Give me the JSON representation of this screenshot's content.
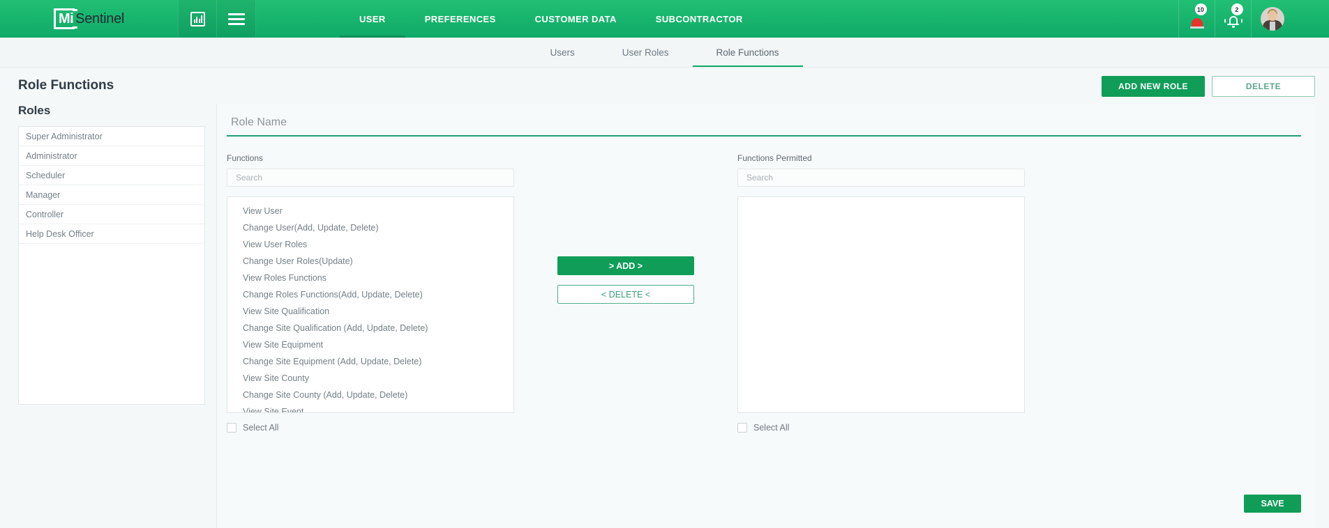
{
  "header": {
    "logo": {
      "mi": "Mi",
      "sentinel": "Sentinel",
      "icon": "logo-misentinel"
    },
    "dashboard_icon": "bar-chart-icon",
    "menu_icon": "hamburger-menu-icon",
    "nav": [
      {
        "label": "USER",
        "active": true
      },
      {
        "label": "PREFERENCES",
        "active": false
      },
      {
        "label": "CUSTOMER DATA",
        "active": false
      },
      {
        "label": "SUBCONTRACTOR",
        "active": false
      }
    ],
    "alerts": {
      "icon": "siren-alarm-icon",
      "badge": "10"
    },
    "notifications": {
      "icon": "bell-icon",
      "badge": "2"
    },
    "avatar": {
      "icon": "user-avatar"
    }
  },
  "subnav": [
    {
      "label": "Users",
      "active": false
    },
    {
      "label": "User Roles",
      "active": false
    },
    {
      "label": "Role Functions",
      "active": true
    }
  ],
  "page": {
    "title": "Role Functions",
    "add_new_role_label": "ADD NEW ROLE",
    "delete_label": "DELETE"
  },
  "roles": {
    "title": "Roles",
    "items": [
      "Super Administrator",
      "Administrator",
      "Scheduler",
      "Manager",
      "Controller",
      "Help Desk Officer"
    ]
  },
  "form": {
    "role_name_placeholder": "Role Name",
    "role_name_value": "",
    "functions": {
      "label": "Functions",
      "search_placeholder": "Search",
      "search_value": "",
      "items": [
        "View User",
        "Change User(Add, Update, Delete)",
        "View User Roles",
        "Change User Roles(Update)",
        "View Roles Functions",
        "Change Roles Functions(Add, Update, Delete)",
        "View Site Qualification",
        "Change Site Qualification (Add, Update, Delete)",
        "View Site Equipment",
        "Change Site Equipment (Add, Update, Delete)",
        "View Site County",
        "Change Site County (Add, Update, Delete)",
        "View Site Event"
      ],
      "select_all_label": "Select All"
    },
    "functions_permitted": {
      "label": "Functions Permitted",
      "search_placeholder": "Search",
      "search_value": "",
      "items": [],
      "select_all_label": "Select All"
    },
    "add_button_label": "> ADD >",
    "delete_button_label": "< DELETE <",
    "save_button_label": "SAVE"
  },
  "colors": {
    "brand_green": "#0faa68",
    "header_gradient_top": "#21bf73",
    "primary_button": "#0f9d58",
    "accent_underline": "#1f9d77",
    "badge_red": "#e8342a"
  }
}
